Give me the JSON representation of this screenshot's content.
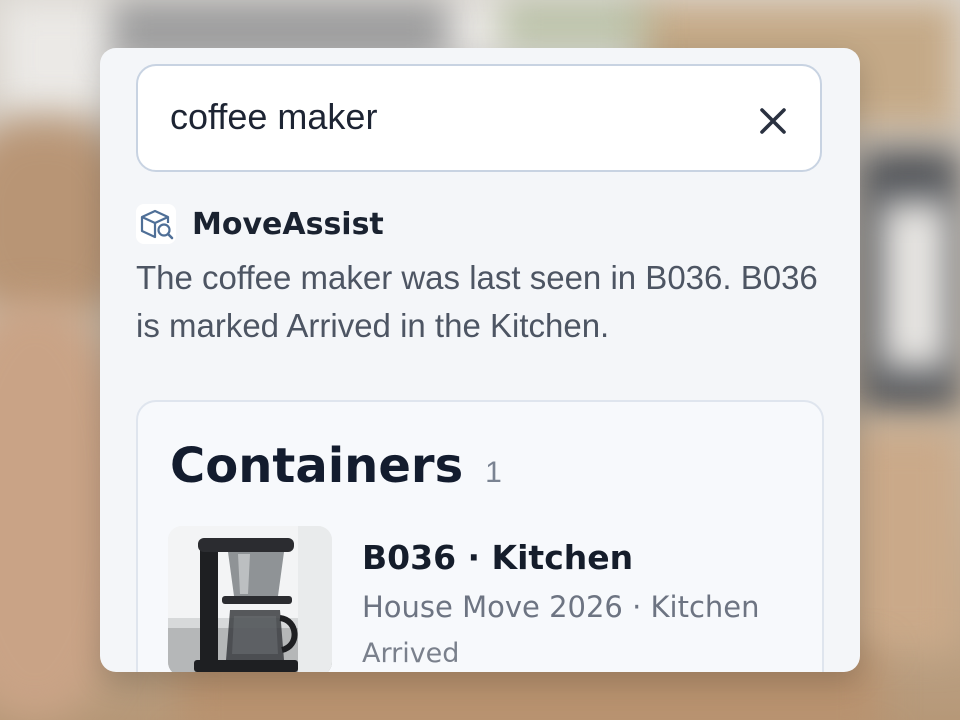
{
  "search": {
    "query": "coffee maker"
  },
  "assistant": {
    "name": "MoveAssist",
    "logo_icon": "box-search-icon",
    "answer": "The coffee maker was last seen in B036. B036 is marked Arrived in the Kitchen."
  },
  "results": {
    "heading": "Containers",
    "count": "1",
    "items": [
      {
        "title": "B036 · Kitchen",
        "subtitle": "House Move 2026 · Kitchen",
        "status": "Arrived",
        "thumbnail": "coffee-maker-photo"
      }
    ]
  },
  "colors": {
    "card_background": "#f4f6f9",
    "heading_text": "#131c2e",
    "body_text": "#4d5563",
    "search_border": "#c8d3e2"
  }
}
